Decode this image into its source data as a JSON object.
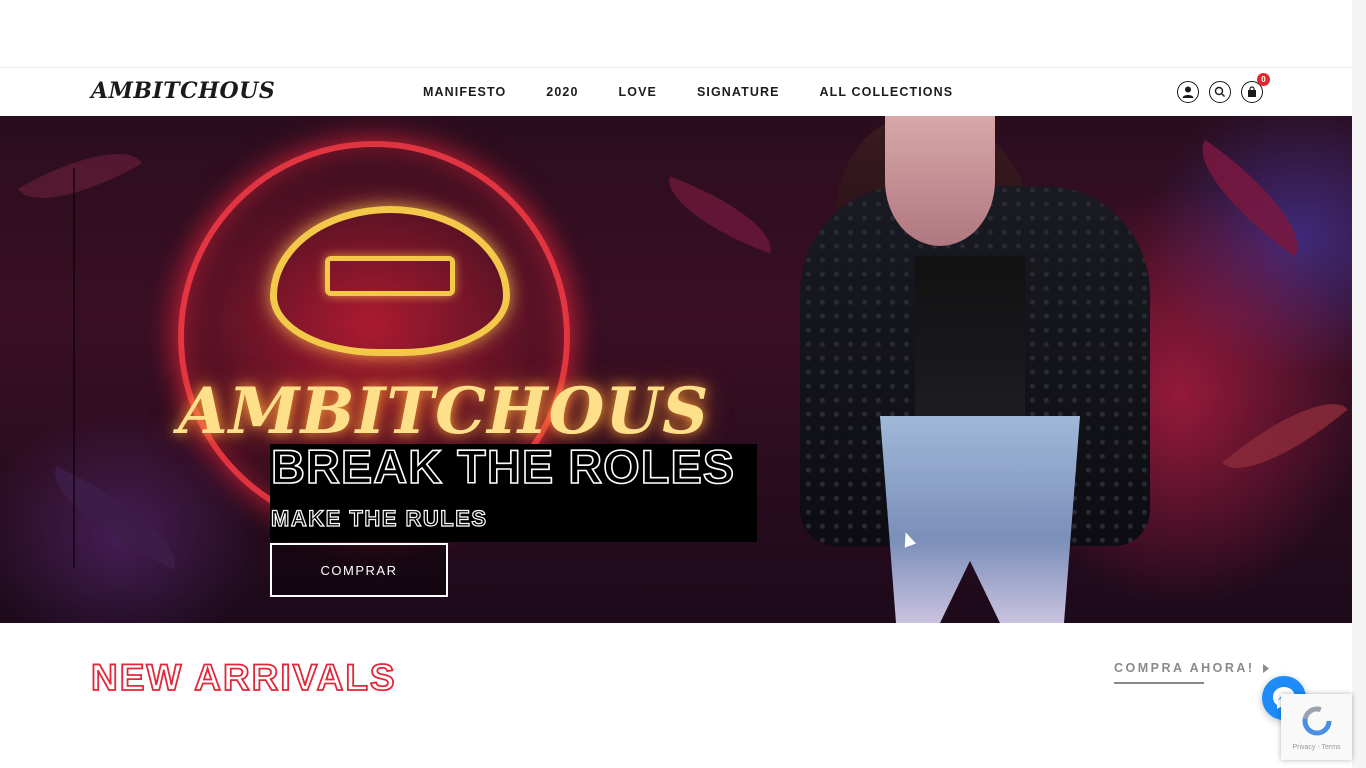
{
  "header": {
    "logo": "AMBITCHOUS",
    "nav": [
      {
        "label": "MANIFESTO"
      },
      {
        "label": "2020"
      },
      {
        "label": "LOVE"
      },
      {
        "label": "SIGNATURE"
      },
      {
        "label": "ALL COLLECTIONS"
      }
    ],
    "cart_count": "0",
    "icons": [
      "user-icon",
      "search-icon",
      "cart-icon"
    ]
  },
  "hero": {
    "neon_text": "AMBITCHOUS",
    "headline": "BREAK THE ROLES",
    "subline": "MAKE THE RULES",
    "button_label": "COMPRAR"
  },
  "section": {
    "title": "NEW ARRIVALS",
    "shop_link": "COMPRA AHORA!"
  },
  "widgets": {
    "chat_icon": "messenger-icon",
    "recaptcha_text": "Privacy - Terms"
  },
  "colors": {
    "accent_red": "#e0283a",
    "messenger_blue": "#1d8cf8",
    "badge_red": "#e4262d"
  }
}
